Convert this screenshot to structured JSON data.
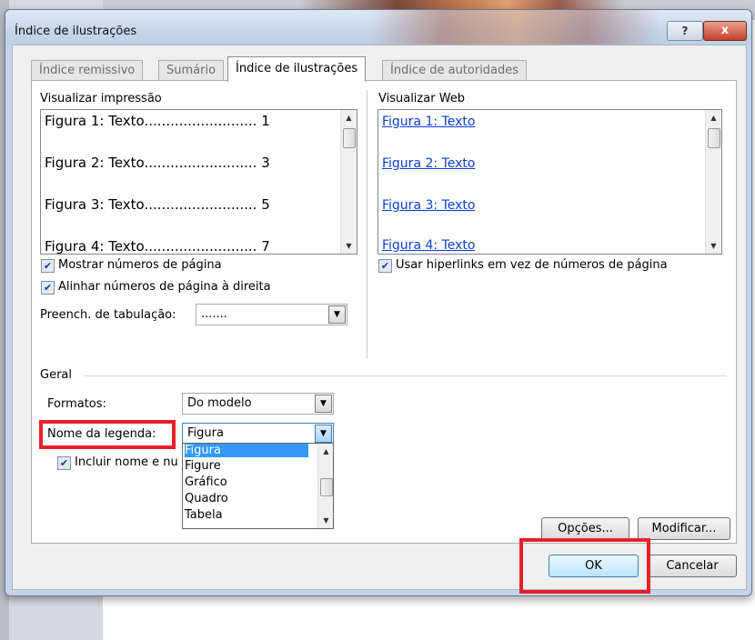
{
  "window": {
    "title": "Índice de ilustrações"
  },
  "title_buttons": {
    "help": "?",
    "close": "x"
  },
  "tabs": [
    {
      "label": "Índice remissivo",
      "active": false
    },
    {
      "label": "Sumário",
      "active": false
    },
    {
      "label": "Índice de ilustrações",
      "active": true
    },
    {
      "label": "Índice de autoridades",
      "active": false
    }
  ],
  "print_preview": {
    "label": "Visualizar impressão",
    "lines": [
      "Figura 1: Texto.......................... 1",
      "Figura 2: Texto.......................... 3",
      "Figura 3: Texto.......................... 5",
      "Figura 4: Texto.......................... 7"
    ]
  },
  "web_preview": {
    "label": "Visualizar Web",
    "links": [
      "Figura 1: Texto",
      "Figura 2: Texto",
      "Figura 3: Texto",
      "Figura 4: Texto"
    ]
  },
  "options": {
    "show_page_numbers": "Mostrar números de página",
    "align_right": "Alinhar números de página à direita",
    "tab_leader_label": "Preench. de tabulação:",
    "tab_leader_value": ".......",
    "use_hyperlinks": "Usar hiperlinks em vez de números de página"
  },
  "general": {
    "label": "Geral",
    "formats_label": "Formatos:",
    "formats_value": "Do modelo",
    "caption_label": "Nome da legenda:",
    "caption_value": "Figura",
    "include_label": "Incluir nome e nu",
    "caption_options": [
      "Figura",
      "Figure",
      "Gráfico",
      "Quadro",
      "Tabela"
    ]
  },
  "buttons": {
    "options": "Opções...",
    "modify": "Modificar...",
    "ok": "OK",
    "cancel": "Cancelar"
  },
  "colors": {
    "highlight": "#e8202a",
    "selection": "#3399ff",
    "link": "#0b3fd4"
  },
  "icons": {
    "checkbox": "check-icon",
    "dropdown": "chevron-down-icon",
    "scroll_up": "scroll-up-arrow-icon",
    "scroll_down": "scroll-down-arrow-icon"
  }
}
